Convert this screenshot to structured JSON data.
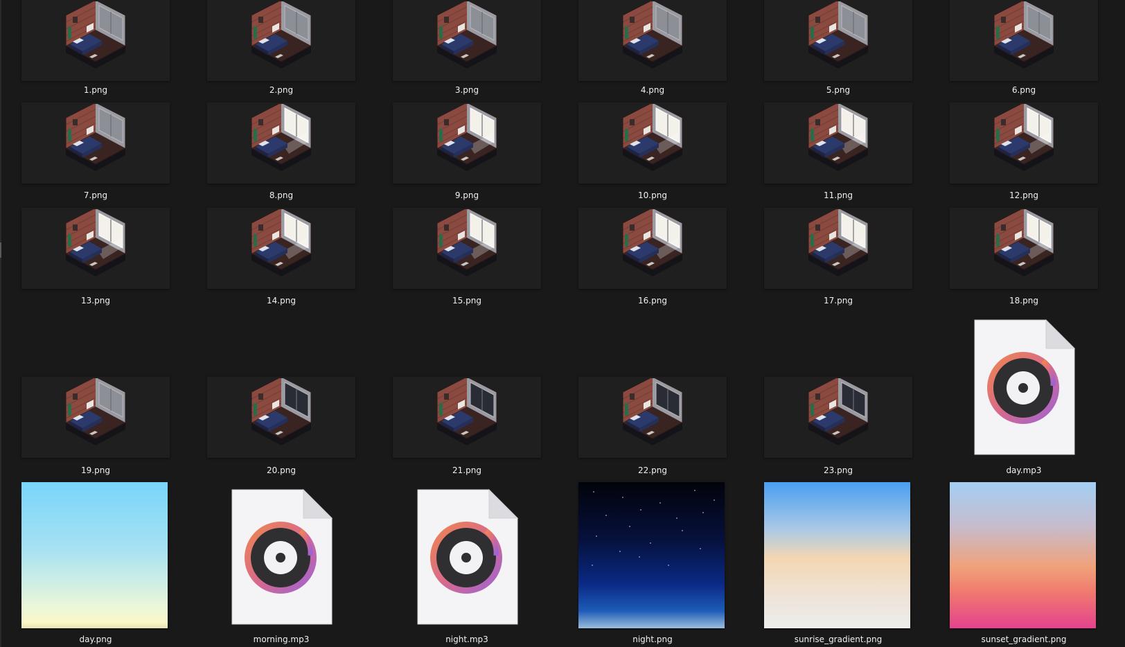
{
  "window": {
    "background": "#191919",
    "text_color": "#f0f0f0"
  },
  "files": {
    "f1": {
      "name": "1.png",
      "type": "image",
      "icon": "isometric-bedroom-thumbnail",
      "light": "dim"
    },
    "f2": {
      "name": "2.png",
      "type": "image",
      "icon": "isometric-bedroom-thumbnail",
      "light": "dim"
    },
    "f3": {
      "name": "3.png",
      "type": "image",
      "icon": "isometric-bedroom-thumbnail",
      "light": "dim"
    },
    "f4": {
      "name": "4.png",
      "type": "image",
      "icon": "isometric-bedroom-thumbnail",
      "light": "dim"
    },
    "f5": {
      "name": "5.png",
      "type": "image",
      "icon": "isometric-bedroom-thumbnail",
      "light": "dim"
    },
    "f6": {
      "name": "6.png",
      "type": "image",
      "icon": "isometric-bedroom-thumbnail",
      "light": "dim"
    },
    "f7": {
      "name": "7.png",
      "type": "image",
      "icon": "isometric-bedroom-thumbnail",
      "light": "dim"
    },
    "f8": {
      "name": "8.png",
      "type": "image",
      "icon": "isometric-bedroom-thumbnail",
      "light": "bright"
    },
    "f9": {
      "name": "9.png",
      "type": "image",
      "icon": "isometric-bedroom-thumbnail",
      "light": "bright"
    },
    "f10": {
      "name": "10.png",
      "type": "image",
      "icon": "isometric-bedroom-thumbnail",
      "light": "bright"
    },
    "f11": {
      "name": "11.png",
      "type": "image",
      "icon": "isometric-bedroom-thumbnail",
      "light": "bright"
    },
    "f12": {
      "name": "12.png",
      "type": "image",
      "icon": "isometric-bedroom-thumbnail",
      "light": "bright"
    },
    "f13": {
      "name": "13.png",
      "type": "image",
      "icon": "isometric-bedroom-thumbnail",
      "light": "bright"
    },
    "f14": {
      "name": "14.png",
      "type": "image",
      "icon": "isometric-bedroom-thumbnail",
      "light": "bright"
    },
    "f15": {
      "name": "15.png",
      "type": "image",
      "icon": "isometric-bedroom-thumbnail",
      "light": "bright"
    },
    "f16": {
      "name": "16.png",
      "type": "image",
      "icon": "isometric-bedroom-thumbnail",
      "light": "bright"
    },
    "f17": {
      "name": "17.png",
      "type": "image",
      "icon": "isometric-bedroom-thumbnail",
      "light": "bright"
    },
    "f18": {
      "name": "18.png",
      "type": "image",
      "icon": "isometric-bedroom-thumbnail",
      "light": "bright"
    },
    "f19": {
      "name": "19.png",
      "type": "image",
      "icon": "isometric-bedroom-thumbnail",
      "light": "dim"
    },
    "f20": {
      "name": "20.png",
      "type": "image",
      "icon": "isometric-bedroom-thumbnail",
      "light": "night"
    },
    "f21": {
      "name": "21.png",
      "type": "image",
      "icon": "isometric-bedroom-thumbnail",
      "light": "night"
    },
    "f22": {
      "name": "22.png",
      "type": "image",
      "icon": "isometric-bedroom-thumbnail",
      "light": "night"
    },
    "f23": {
      "name": "23.png",
      "type": "image",
      "icon": "isometric-bedroom-thumbnail",
      "light": "night"
    },
    "day_mp3": {
      "name": "day.mp3",
      "type": "audio",
      "icon": "music-file-icon"
    },
    "day_png": {
      "name": "day.png",
      "type": "image",
      "icon": "sky-gradient-thumbnail",
      "colors": [
        "#79d5fb",
        "#fbf7c8"
      ]
    },
    "morning_mp3": {
      "name": "morning.mp3",
      "type": "audio",
      "icon": "music-file-icon"
    },
    "night_mp3": {
      "name": "night.mp3",
      "type": "audio",
      "icon": "music-file-icon"
    },
    "night_png": {
      "name": "night.png",
      "type": "image",
      "icon": "night-sky-thumbnail",
      "colors": [
        "#02030a",
        "#0a2a86",
        "#9bbedc"
      ]
    },
    "sunrise_png": {
      "name": "sunrise_gradient.png",
      "type": "image",
      "icon": "sunrise-gradient-thumbnail",
      "colors": [
        "#4a9ef0",
        "#f4d7b2",
        "#ededed"
      ]
    },
    "sunset_png": {
      "name": "sunset_gradient.png",
      "type": "image",
      "icon": "sunset-gradient-thumbnail",
      "colors": [
        "#a4cff4",
        "#f0a27a",
        "#e5428d"
      ]
    }
  },
  "icon_colors": {
    "music_ring_gradient": [
      "#f0884a",
      "#d86a8a",
      "#9a63d8"
    ],
    "music_disc": "#2f2f31",
    "document_page": "#f4f4f6",
    "brick": "#8a4a40",
    "floor": "#3a2422",
    "bed": "#2c3a6b"
  }
}
